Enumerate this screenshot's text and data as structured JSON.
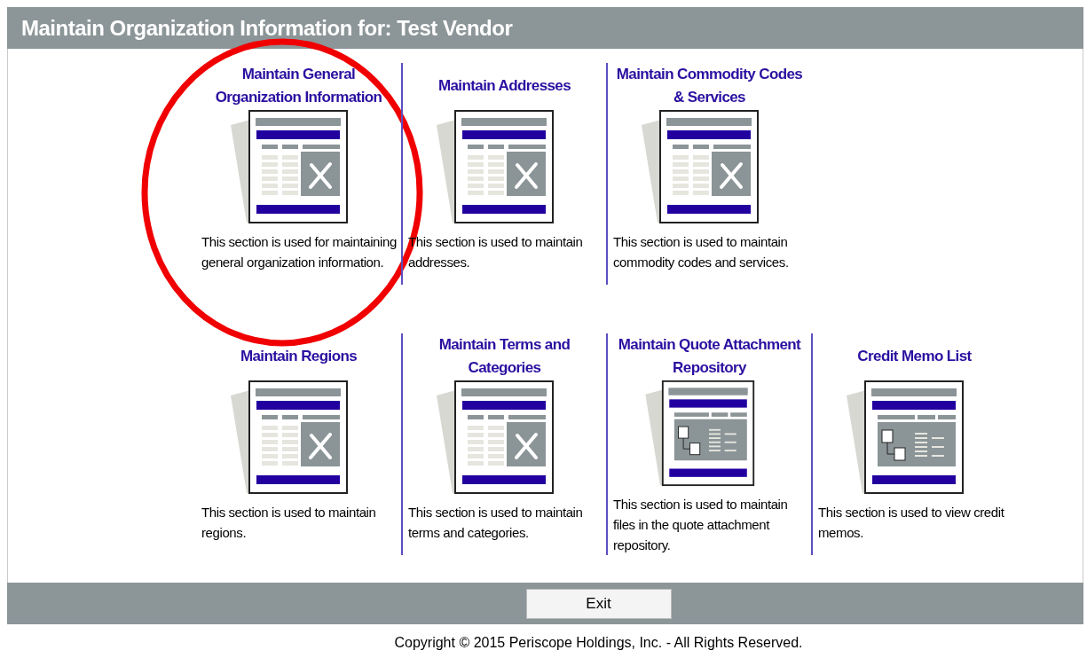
{
  "window": {
    "title": "Maintain Organization Information for: Test Vendor"
  },
  "sections": [
    [
      {
        "title": "Maintain General Organization Information",
        "kind": "tools",
        "description": "This section is used for maintaining general organization information.",
        "highlighted": true
      },
      {
        "title": "Maintain Addresses",
        "kind": "tools",
        "description": "This section is used to maintain addresses.",
        "highlighted": false
      },
      {
        "title": "Maintain Commodity Codes & Services",
        "kind": "tools",
        "description": "This section is used to maintain commodity codes and services.",
        "highlighted": false
      }
    ],
    [
      {
        "title": "Maintain Regions",
        "kind": "tools",
        "description": "This section is used to maintain regions.",
        "highlighted": false
      },
      {
        "title": "Maintain Terms and Categories",
        "kind": "tools",
        "description": "This section is used to maintain terms and categories.",
        "highlighted": false
      },
      {
        "title": "Maintain Quote Attachment Repository",
        "kind": "files",
        "description": "This section is used to maintain files in the quote attachment repository.",
        "highlighted": false
      },
      {
        "title": "Credit Memo List",
        "kind": "files",
        "description": "This section is used to view credit memos.",
        "highlighted": false
      }
    ]
  ],
  "buttons": [
    "Exit"
  ],
  "footer": "Copyright © 2015 Periscope Holdings, Inc. - All Rights Reserved."
}
